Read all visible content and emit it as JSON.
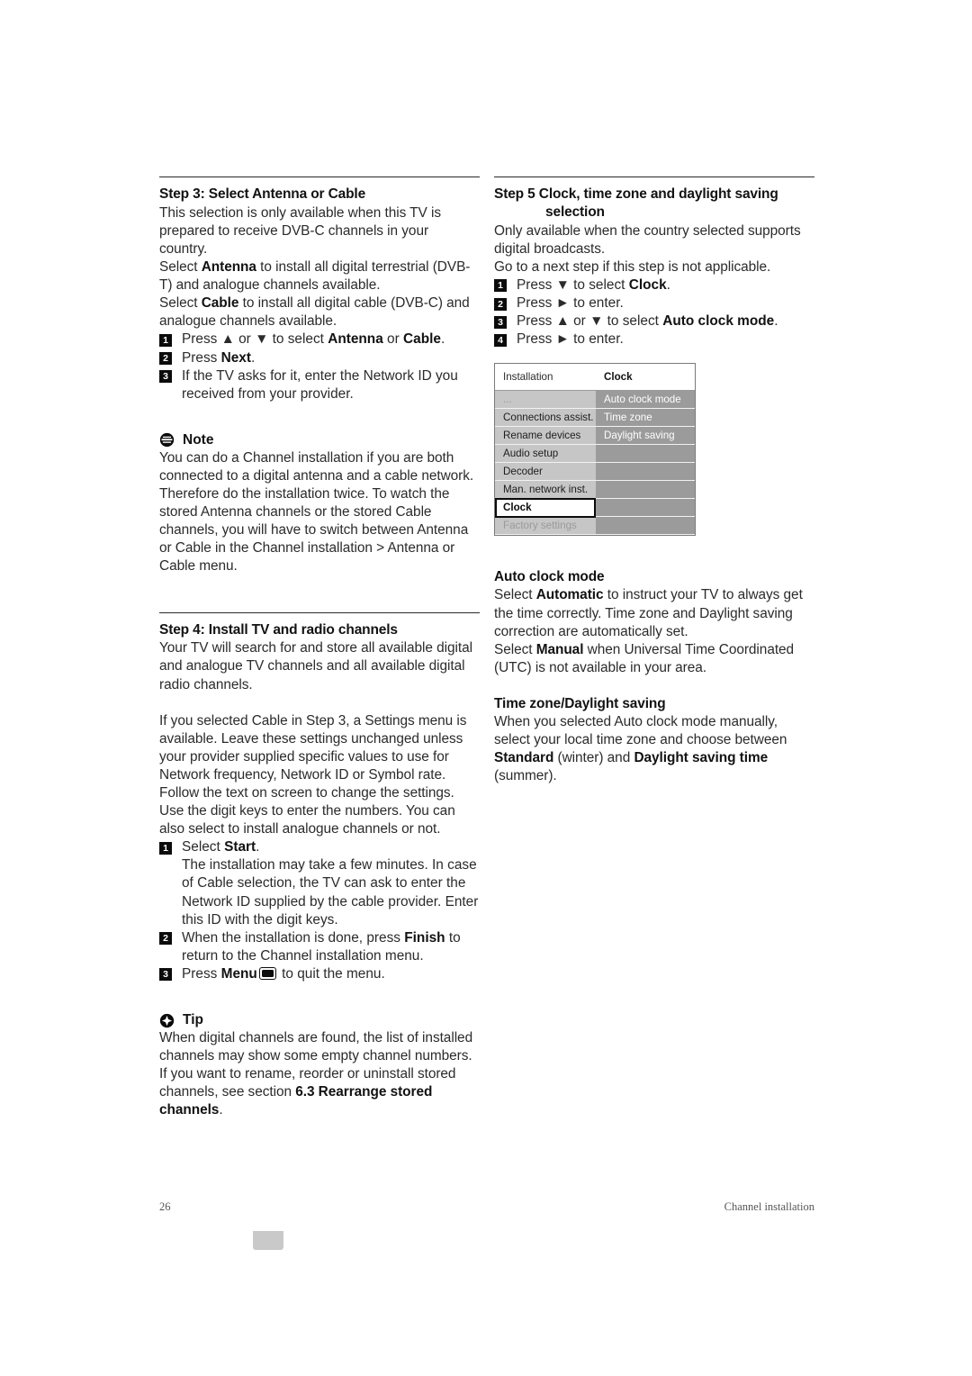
{
  "page": {
    "number": "26",
    "section": "Channel installation"
  },
  "left_column": {
    "step3": {
      "heading": "Step 3:  Select  Antenna or Cable",
      "paragraphs": [
        "This selection is only available when this TV is prepared to receive DVB-C channels in your country.",
        "Select Antenna to install all digital terrestrial (DVB-T) and analogue channels available.",
        "Select Cable to install all digital cable (DVB-C) and analogue channels available."
      ],
      "p1_a": "This selection is only available when this TV is prepared to receive DVB-C channels in your country.",
      "p2_a": "Select ",
      "p2_b": "Antenna",
      "p2_c": " to install all digital terrestrial (DVB-T) and analogue channels available.",
      "p3_a": "Select ",
      "p3_b": "Cable",
      "p3_c": " to install all digital cable (DVB-C) and analogue channels available.",
      "steps": [
        {
          "num": "1",
          "a": "Press ▲ or ▼ to select ",
          "b": "Antenna",
          "c": " or ",
          "d": "Cable",
          "e": "."
        },
        {
          "num": "2",
          "a": "Press ",
          "b": "Next",
          "c": "."
        },
        {
          "num": "3",
          "a": "If the TV asks for it, enter the Network ID you received from your provider.",
          "b": "",
          "c": ""
        }
      ]
    },
    "note": {
      "icon": "note-icon",
      "label": "Note",
      "text": "You can do a Channel installation if you are both connected to a digital antenna and a cable network. Therefore do the installation twice. To watch the stored Antenna channels or the stored Cable channels, you will have to switch between Antenna or Cable in the Channel installation > Antenna or Cable menu."
    },
    "step4": {
      "heading": "Step 4: Install TV and radio channels",
      "p1": "Your TV will search for and store all available digital and analogue TV channels and all available digital radio channels.",
      "p2": "If you selected Cable in Step 3, a Settings menu is available. Leave these settings unchanged unless your provider supplied specific values to use for Network frequency, Network ID or Symbol rate. Follow the text on screen to change the settings. Use the digit keys to enter the numbers. You can also select to install analogue channels or not.",
      "steps": [
        {
          "num": "1",
          "a": "Select ",
          "b": "Start",
          "c": ".",
          "sub": "The installation may take a few minutes. In case of Cable selection, the TV can ask to enter the Network ID supplied by the cable provider. Enter this ID with the digit keys."
        },
        {
          "num": "2",
          "a": "When the installation is done, press ",
          "b": "Finish",
          "c": " to return to the Channel installation menu.",
          "sub": ""
        },
        {
          "num": "3",
          "a": "Press ",
          "b": "Menu",
          "c": " to quit the menu.",
          "sub": "",
          "icon": "menu-key-icon"
        }
      ]
    },
    "tip": {
      "icon": "tip-icon",
      "label": "Tip",
      "a": "When digital channels are found, the list of installed channels may show some empty channel numbers. If you want to rename, reorder or uninstall stored channels, see section ",
      "b": "6.3 Rearrange stored channels",
      "c": "."
    }
  },
  "right_column": {
    "step5": {
      "heading_line1": "Step 5  Clock, time zone and daylight saving",
      "heading_line2": "selection",
      "p1": "Only available when the country selected supports digital broadcasts.",
      "p2": "Go to a next step if this step is not applicable.",
      "steps": [
        {
          "num": "1",
          "a": "Press ▼ to select ",
          "b": "Clock",
          "c": "."
        },
        {
          "num": "2",
          "a": "Press ► to enter.",
          "b": "",
          "c": ""
        },
        {
          "num": "3",
          "a": "Press ▲ or ▼ to select ",
          "b": "Auto clock mode",
          "c": "."
        },
        {
          "num": "4",
          "a": "Press ► to enter.",
          "b": "",
          "c": ""
        }
      ]
    },
    "osd": {
      "title_left": "Installation",
      "title_right": "Clock",
      "left_items": [
        {
          "label": "...",
          "state": "dim"
        },
        {
          "label": "Connections assist.",
          "state": "normal"
        },
        {
          "label": "Rename devices",
          "state": "normal"
        },
        {
          "label": "Audio setup",
          "state": "normal"
        },
        {
          "label": "Decoder",
          "state": "normal"
        },
        {
          "label": "Man. network inst.",
          "state": "normal"
        },
        {
          "label": "Clock",
          "state": "selected"
        },
        {
          "label": "Factory settings",
          "state": "dim"
        }
      ],
      "right_items": [
        {
          "label": "Auto clock mode",
          "state": "normal"
        },
        {
          "label": "Time zone",
          "state": "normal"
        },
        {
          "label": "Daylight saving",
          "state": "normal"
        },
        {
          "label": "",
          "state": "blank"
        },
        {
          "label": "",
          "state": "blank"
        },
        {
          "label": "",
          "state": "blank"
        },
        {
          "label": "",
          "state": "blank"
        },
        {
          "label": "",
          "state": "blank"
        }
      ],
      "colors": {
        "left_panel": "#c6c6c6",
        "right_panel": "#9b9b9b",
        "selected_bg": "#ffffff",
        "selected_border": "#0b0b0b"
      }
    },
    "auto_clock": {
      "heading": "Auto clock mode",
      "a1": "Select ",
      "b1": "Automatic",
      "c1": " to instruct your TV to always get the time correctly. Time zone and Daylight saving correction are automatically set.",
      "a2": "Select ",
      "b2": "Manual",
      "c2": " when Universal Time Coordinated (UTC) is not available in your area."
    },
    "time_zone": {
      "heading": "Time zone/Daylight saving",
      "a": "When you selected Auto clock mode manually, select your local time zone and choose between ",
      "b1": "Standard",
      "mid1": " (winter) and ",
      "b2": "Daylight saving time",
      "end": " (summer)."
    }
  }
}
